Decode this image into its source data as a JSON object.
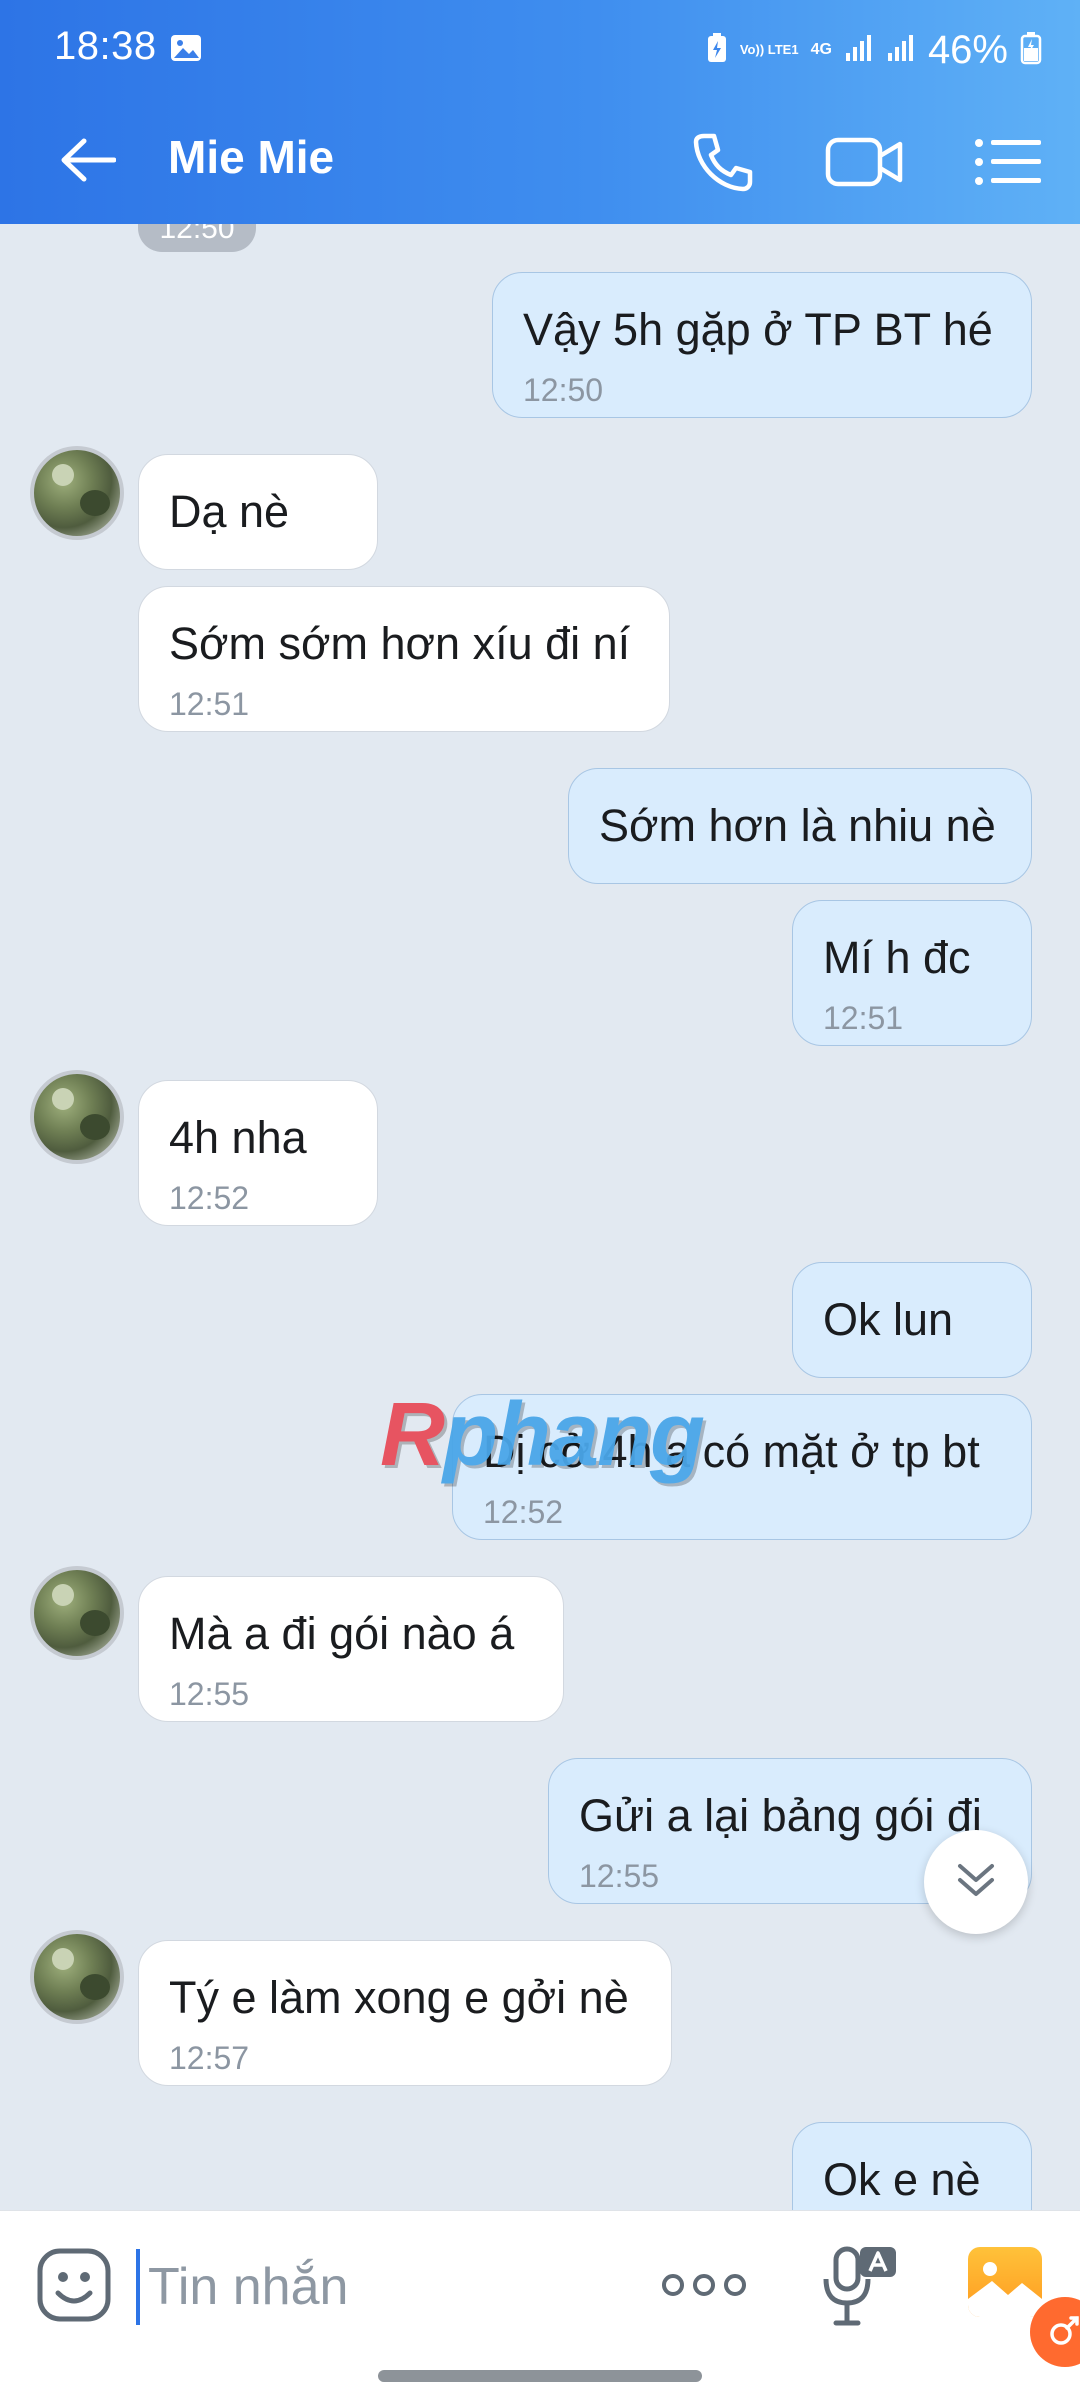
{
  "status_bar": {
    "time": "18:38",
    "battery": "46%",
    "network_labels": [
      "Vo)) LTE1",
      "4G"
    ],
    "icons": [
      "image-icon",
      "battery-saver-icon",
      "volte-icon",
      "4g-icon",
      "signal-icon",
      "signal-icon",
      "battery-icon"
    ]
  },
  "header": {
    "contact_name": "Mie Mie",
    "icons": [
      "back-arrow-icon",
      "phone-icon",
      "video-call-icon",
      "menu-list-icon"
    ],
    "color_left": "#2d74e6",
    "color_right": "#5fb1f6"
  },
  "chat": {
    "partial_time_chip": "12:50",
    "messages": [
      {
        "dir": "out",
        "text": "Vậy 5h gặp ở TP BT hé",
        "time": "12:50"
      },
      {
        "dir": "in",
        "text": "Dạ nè",
        "time": ""
      },
      {
        "dir": "in",
        "text": "Sớm sớm hơn xíu đi ní",
        "time": "12:51"
      },
      {
        "dir": "out",
        "text": "Sớm hơn là nhiu nè",
        "time": ""
      },
      {
        "dir": "out",
        "text": "Mí h đc",
        "time": "12:51"
      },
      {
        "dir": "in",
        "text": "4h nha",
        "time": "12:52"
      },
      {
        "dir": "out",
        "text": "Ok lun",
        "time": ""
      },
      {
        "dir": "out",
        "text": "Dị cở 4h a có mặt ở tp bt",
        "time": "12:52"
      },
      {
        "dir": "in",
        "text": "Mà a đi gói nào á",
        "time": "12:55"
      },
      {
        "dir": "out",
        "text": "Gửi a lại bảng gói đi",
        "time": "12:55"
      },
      {
        "dir": "in",
        "text": "Tý e làm xong e gởi nè",
        "time": "12:57"
      },
      {
        "dir": "out",
        "text": "Ok e nè",
        "time": ""
      }
    ],
    "watermark": "Rphang",
    "incoming_color": "#ffffff",
    "outgoing_color": "#d9ecfd",
    "background_color": "#e2e9f1"
  },
  "input_bar": {
    "placeholder": "Tin nhắn",
    "icons": [
      "emoji-icon",
      "more-options-icon",
      "voice-to-text-icon",
      "gallery-icon"
    ]
  }
}
